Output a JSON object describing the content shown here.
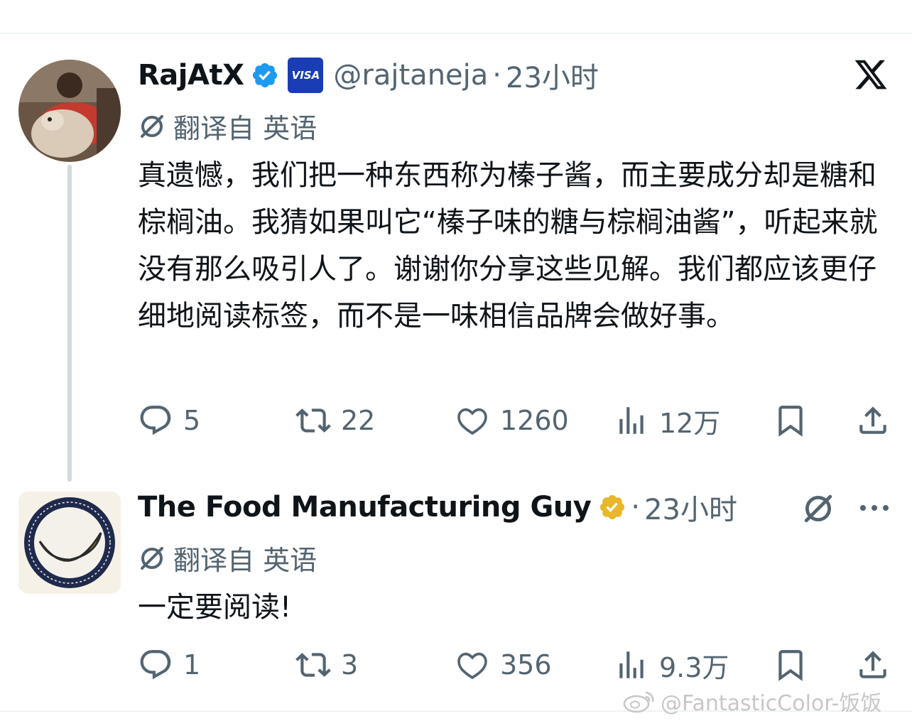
{
  "tweets": [
    {
      "author": "RajAtX",
      "handle": "@rajtaneja",
      "separator": "·",
      "time": "23小时",
      "visa_label": "VISA",
      "translate_label": "翻译自 英语",
      "text": "真遗憾，我们把一种东西称为榛子酱，而主要成分却是糖和棕榈油。我猜如果叫它“榛子味的糖与棕榈油酱”，听起来就没有那么吸引人了。谢谢你分享这些见解。我们都应该更仔细地阅读标签，而不是一味相信品牌会做好事。",
      "actions": {
        "replies": "5",
        "reposts": "22",
        "likes": "1260",
        "views": "12万"
      }
    },
    {
      "author": "The Food Manufacturing Guy",
      "separator": "·",
      "time": "23小时",
      "translate_label": "翻译自 英语",
      "text": "一定要阅读!",
      "actions": {
        "replies": "1",
        "reposts": "3",
        "likes": "356",
        "views": "9.3万"
      }
    }
  ],
  "watermark": "@FantasticColor-饭饭",
  "colors": {
    "verified_blue": "#1d9bf0",
    "verified_gold": "#e8b829",
    "muted": "#536471",
    "text": "#0f1419"
  },
  "icons": [
    "verified-badge-icon",
    "visa-badge-icon",
    "x-logo-icon",
    "translate-icon",
    "reply-icon",
    "repost-icon",
    "like-icon",
    "views-icon",
    "bookmark-icon",
    "share-icon",
    "more-icon",
    "weibo-icon"
  ]
}
